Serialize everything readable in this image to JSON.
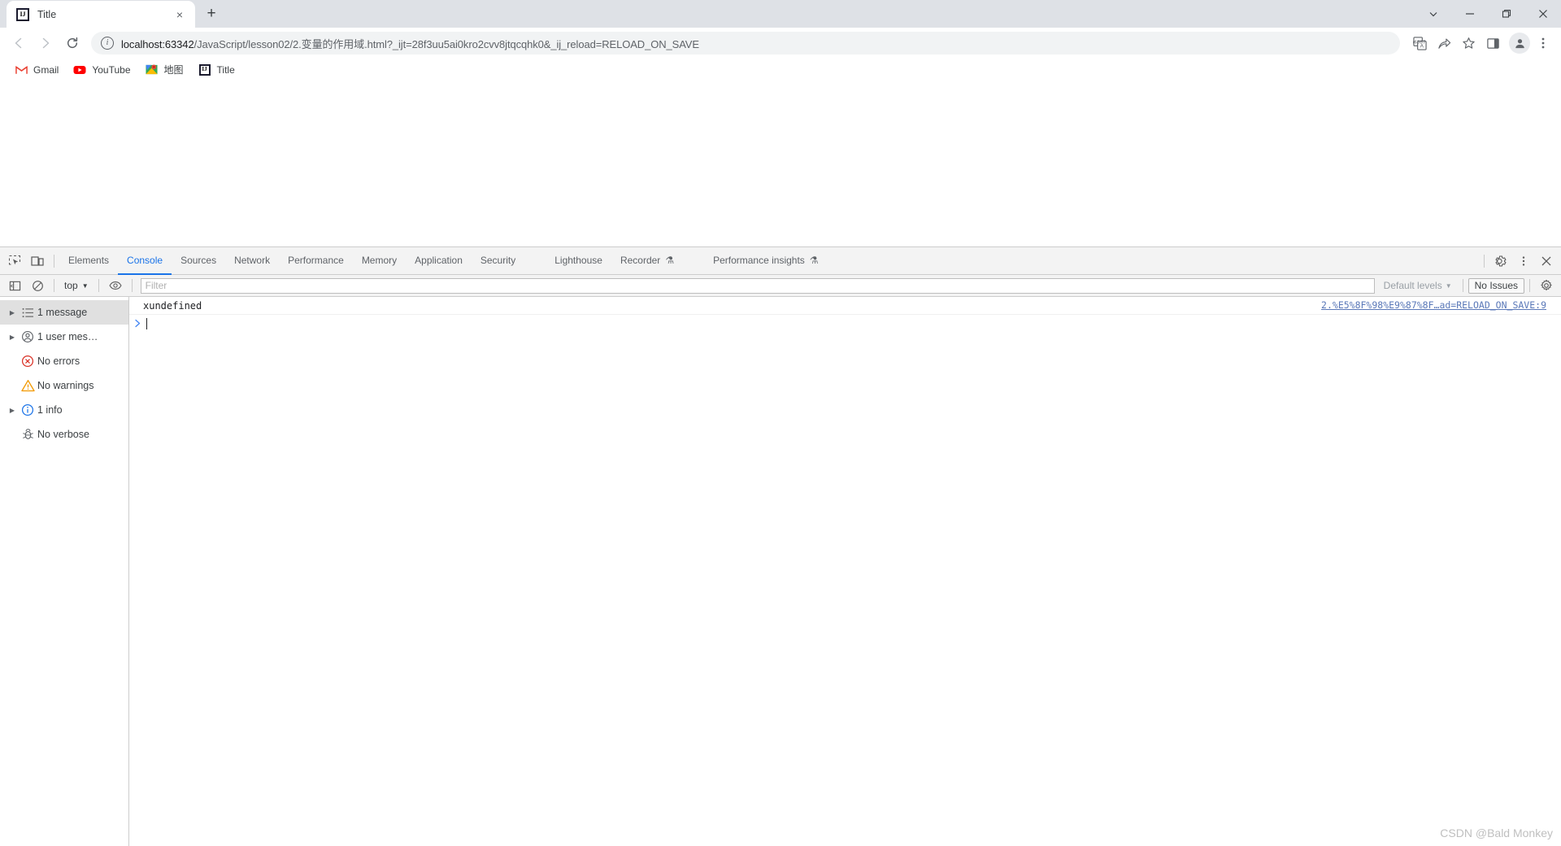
{
  "browser": {
    "tab": {
      "title": "Title",
      "favicon": "intellij-idea-icon",
      "close": "×"
    },
    "new_tab_label": "+",
    "window_controls": [
      {
        "name": "minimize-tab-search-button",
        "glyph": "⌄"
      },
      {
        "name": "minimize-button",
        "glyph": "–"
      },
      {
        "name": "maximize-button",
        "glyph": "❐"
      },
      {
        "name": "close-window-button",
        "glyph": "✕"
      }
    ],
    "nav": {
      "back": "←",
      "forward": "→",
      "reload": "↻"
    },
    "omnibox": {
      "info_icon": "i",
      "host": "localhost:63342",
      "path": "/JavaScript/lesson02/2.变量的作用域.html?_ijt=28f3uu5ai0kro2cvv8jtqcqhk0&_ij_reload=RELOAD_ON_SAVE"
    },
    "toolbar_icons": [
      {
        "name": "translate-icon",
        "glyph": "文A"
      },
      {
        "name": "share-icon",
        "glyph": "➦"
      },
      {
        "name": "bookmark-star-icon",
        "glyph": "☆"
      },
      {
        "name": "side-panel-icon",
        "glyph": "▧"
      },
      {
        "name": "profile-avatar-icon",
        "glyph": "●"
      },
      {
        "name": "chrome-menu-icon",
        "glyph": "⋮"
      }
    ],
    "bookmarks": [
      {
        "label": "Gmail",
        "icon": "gmail-icon"
      },
      {
        "label": "YouTube",
        "icon": "youtube-icon"
      },
      {
        "label": "地图",
        "icon": "google-maps-icon"
      },
      {
        "label": "Title",
        "icon": "intellij-idea-icon"
      }
    ]
  },
  "devtools": {
    "left_icons": [
      {
        "name": "inspect-element-icon"
      },
      {
        "name": "device-toolbar-icon"
      }
    ],
    "tabs": [
      {
        "label": "Elements",
        "active": false,
        "flask": false
      },
      {
        "label": "Console",
        "active": true,
        "flask": false
      },
      {
        "label": "Sources",
        "active": false,
        "flask": false
      },
      {
        "label": "Network",
        "active": false,
        "flask": false
      },
      {
        "label": "Performance",
        "active": false,
        "flask": false
      },
      {
        "label": "Memory",
        "active": false,
        "flask": false
      },
      {
        "label": "Application",
        "active": false,
        "flask": false
      },
      {
        "label": "Security",
        "active": false,
        "flask": false
      },
      {
        "label": "Lighthouse",
        "active": false,
        "flask": false
      },
      {
        "label": "Recorder",
        "active": false,
        "flask": true
      },
      {
        "label": "Performance insights",
        "active": false,
        "flask": true
      }
    ],
    "flask_glyph": "⚗",
    "right_icons": [
      {
        "name": "devtools-settings-gear-icon"
      },
      {
        "name": "devtools-more-options-icon"
      },
      {
        "name": "devtools-close-icon"
      }
    ],
    "filterbar": {
      "sidebar_toggle": "show-console-sidebar-icon",
      "clear_console": "clear-console-icon",
      "context": "top",
      "context_caret": "▼",
      "live_expression": "eye-icon",
      "filter_placeholder": "Filter",
      "filter_value": "",
      "levels_label": "Default levels",
      "levels_caret": "▼",
      "issues_label": "No Issues",
      "settings_icon": "console-settings-gear-icon"
    },
    "sidebar": [
      {
        "label": "1 message",
        "icon": "list-icon",
        "arrow": true,
        "selected": true
      },
      {
        "label": "1 user mes…",
        "icon": "user-message-icon",
        "arrow": true,
        "selected": false
      },
      {
        "label": "No errors",
        "icon": "error-icon",
        "arrow": false,
        "selected": false
      },
      {
        "label": "No warnings",
        "icon": "warning-icon",
        "arrow": false,
        "selected": false
      },
      {
        "label": "1 info",
        "icon": "info-icon",
        "arrow": true,
        "selected": false
      },
      {
        "label": "No verbose",
        "icon": "verbose-bug-icon",
        "arrow": false,
        "selected": false
      }
    ],
    "console": {
      "messages": [
        {
          "text": "xundefined",
          "source": "2.%E5%8F%98%E9%87%8F…ad=RELOAD_ON_SAVE:9"
        }
      ],
      "prompt_arrow": "❯",
      "prompt_value": ""
    }
  },
  "watermark": "CSDN @Bald Monkey",
  "colors": {
    "accent_blue": "#1a73e8",
    "link_blue": "#5a78b8",
    "chrome_bg": "#dee1e6",
    "devtools_bg": "#f3f3f3",
    "error_red": "#d93025",
    "warning_orange": "#f29900",
    "info_blue": "#1a73e8"
  }
}
